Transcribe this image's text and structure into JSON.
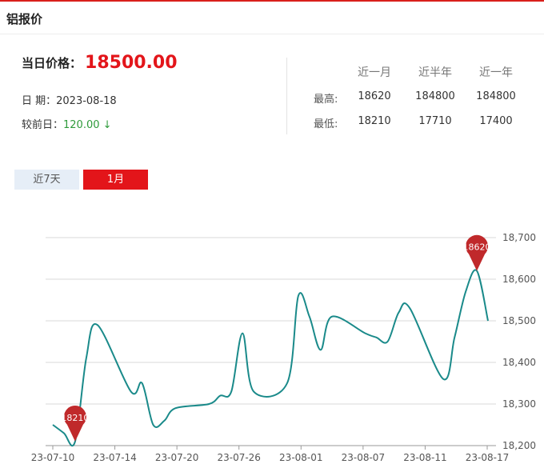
{
  "header": {
    "title": "铝报价"
  },
  "price": {
    "label": "当日价格：",
    "value": "18500.00"
  },
  "date": {
    "label": "日 期：",
    "value": "2023-08-18"
  },
  "change": {
    "label": "较前日：",
    "value": "120.00",
    "arrow": "↓"
  },
  "stats": {
    "headers": [
      "近一月",
      "近半年",
      "近一年"
    ],
    "rows": [
      {
        "label": "最高:",
        "values": [
          "18620",
          "184800",
          "184800"
        ]
      },
      {
        "label": "最低:",
        "values": [
          "18210",
          "17710",
          "17400"
        ]
      }
    ]
  },
  "tabs": [
    {
      "label": "近7天",
      "active": false
    },
    {
      "label": "1月",
      "active": true
    }
  ],
  "colors": {
    "accent": "#e3151a",
    "line": "#1a8a8a",
    "marker": "#c0292b",
    "down": "#2e9a3a"
  },
  "chart_data": {
    "type": "line",
    "title": "",
    "xlabel": "",
    "ylabel": "",
    "ylim": [
      18200,
      18700
    ],
    "yticks": [
      18200,
      18300,
      18400,
      18500,
      18600,
      18700
    ],
    "ytick_labels": [
      "18,200",
      "18,300",
      "18,400",
      "18,500",
      "18,600",
      "18,700"
    ],
    "xtick_labels": [
      "23-07-10",
      "23-07-14",
      "23-07-20",
      "23-07-26",
      "23-08-01",
      "23-08-07",
      "23-08-11",
      "23-08-17"
    ],
    "grid": true,
    "series": [
      {
        "x": [
          "2023-07-10",
          "2023-07-11",
          "2023-07-12",
          "2023-07-13",
          "2023-07-14",
          "2023-07-17",
          "2023-07-18",
          "2023-07-19",
          "2023-07-20",
          "2023-07-21",
          "2023-07-24",
          "2023-07-25",
          "2023-07-26",
          "2023-07-27",
          "2023-07-28",
          "2023-07-31",
          "2023-08-01",
          "2023-08-02",
          "2023-08-03",
          "2023-08-04",
          "2023-08-07",
          "2023-08-08",
          "2023-08-09",
          "2023-08-10",
          "2023-08-11",
          "2023-08-14",
          "2023-08-15",
          "2023-08-16",
          "2023-08-17",
          "2023-08-18"
        ],
        "values": [
          18250,
          18230,
          18210,
          18410,
          18490,
          18330,
          18350,
          18250,
          18260,
          18290,
          18300,
          18320,
          18330,
          18470,
          18330,
          18350,
          18560,
          18510,
          18430,
          18510,
          18470,
          18460,
          18450,
          18520,
          18530,
          18360,
          18460,
          18570,
          18620,
          18500
        ]
      }
    ],
    "annotations": [
      {
        "label": "18210",
        "x": "2023-07-12",
        "value": 18210
      },
      {
        "label": "18620",
        "x": "2023-08-17",
        "value": 18620
      }
    ]
  }
}
